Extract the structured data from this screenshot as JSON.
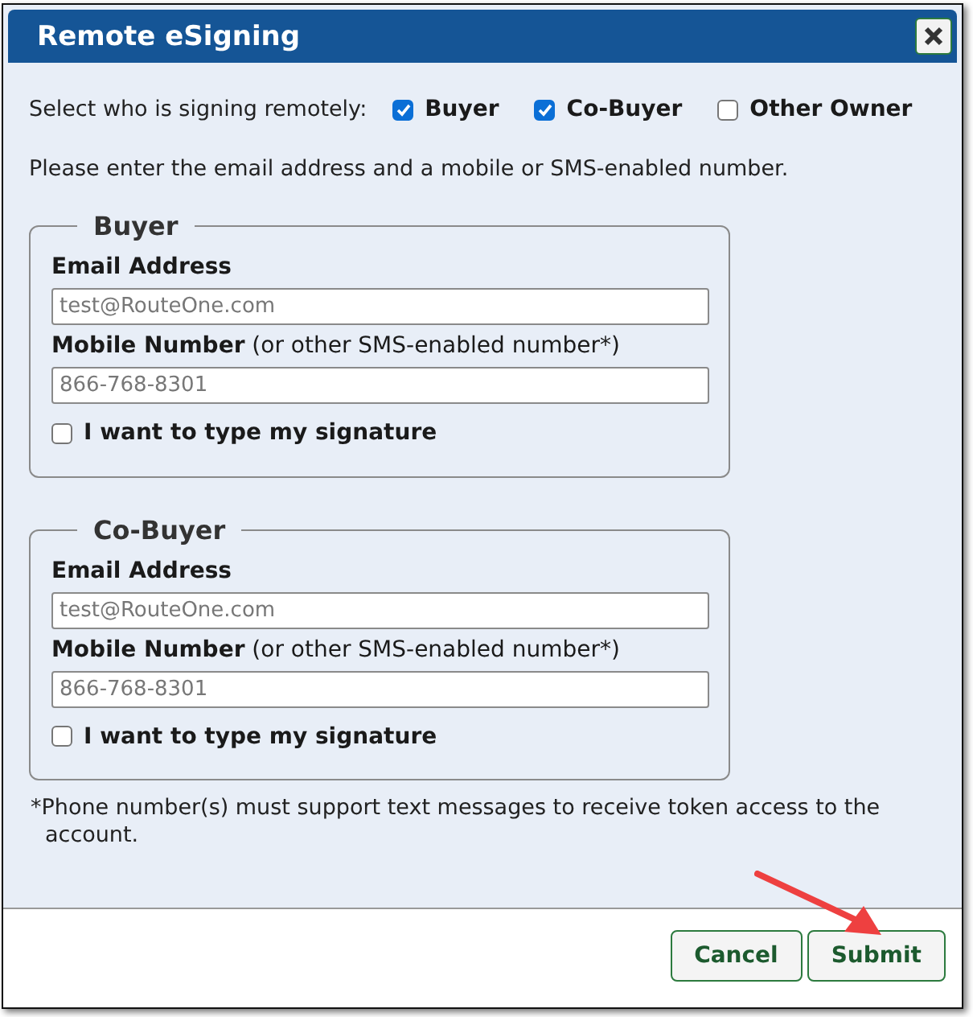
{
  "window": {
    "title": "Remote eSigning"
  },
  "signers": {
    "label": "Select who is signing remotely:",
    "options": [
      {
        "label": "Buyer",
        "checked": true
      },
      {
        "label": "Co-Buyer",
        "checked": true
      },
      {
        "label": "Other Owner",
        "checked": false
      }
    ]
  },
  "instructions": "Please enter the email address and a mobile or SMS-enabled number.",
  "sections": [
    {
      "legend": "Buyer",
      "email": {
        "label": "Email Address",
        "placeholder": "test@RouteOne.com"
      },
      "mobile": {
        "label": "**Mobile Number** (or other SMS-enabled number*)",
        "placeholder": "866-768-8301"
      },
      "type_signature": {
        "label": "I want to type my signature",
        "checked": false
      }
    },
    {
      "legend": "Co-Buyer",
      "email": {
        "label": "Email Address",
        "placeholder": "test@RouteOne.com"
      },
      "mobile": {
        "label": "**Mobile Number** (or other SMS-enabled number*)",
        "placeholder": "866-768-8301"
      },
      "type_signature": {
        "label": "I want to type my signature",
        "checked": false
      }
    }
  ],
  "footnote": "*Phone number(s) must support text messages to receive token access to the account.",
  "buttons": [
    {
      "label": "Cancel"
    },
    {
      "label": "Submit"
    }
  ]
}
